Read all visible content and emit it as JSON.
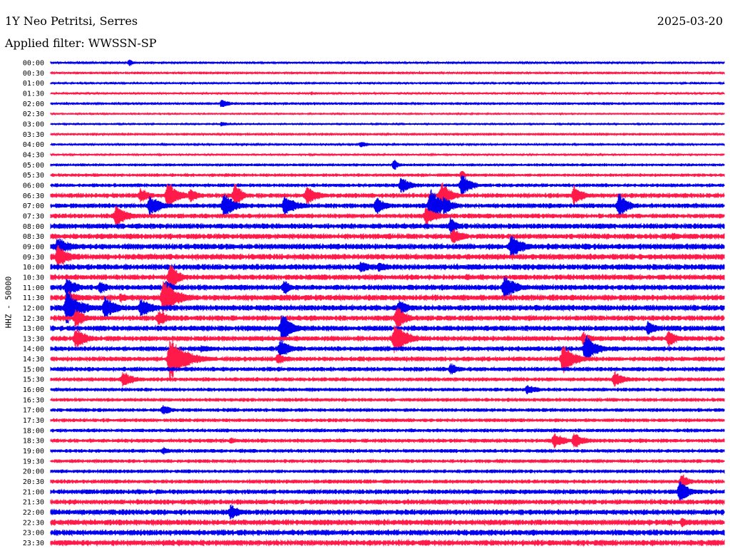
{
  "header": {
    "station": "1Y Neo Petritsi, Serres",
    "date": "2025-03-20",
    "filter": "Applied filter: WWSSN-SP",
    "channel": "HHZ - 50000"
  },
  "colors": {
    "trace_a": "#0000ee",
    "trace_b": "#ff1a4a",
    "text": "#000000"
  },
  "chart_data": {
    "type": "helicorder",
    "x": {
      "unit": "minutes past row start",
      "range": [
        0,
        30
      ]
    },
    "row_labels": [
      "00:00",
      "00:30",
      "01:00",
      "01:30",
      "02:00",
      "02:30",
      "03:00",
      "03:30",
      "04:00",
      "04:30",
      "05:00",
      "05:30",
      "06:00",
      "06:30",
      "07:00",
      "07:30",
      "08:00",
      "08:30",
      "09:00",
      "09:30",
      "10:00",
      "10:30",
      "11:00",
      "11:30",
      "12:00",
      "12:30",
      "13:00",
      "13:30",
      "14:00",
      "14:30",
      "15:00",
      "15:30",
      "16:00",
      "16:30",
      "17:00",
      "17:30",
      "18:00",
      "18:30",
      "19:00",
      "19:30",
      "20:00",
      "20:30",
      "21:00",
      "21:30",
      "22:00",
      "22:30",
      "23:00",
      "23:30"
    ],
    "series_color_pattern": [
      "trace_a",
      "trace_b"
    ],
    "noise_level": [
      1.0,
      1.2,
      0.8,
      0.8,
      1.2,
      0.7,
      0.7,
      1.2,
      0.9,
      0.8,
      1.3,
      1.6,
      1.8,
      2.4,
      2.4,
      2.4,
      2.8,
      2.8,
      3.0,
      3.0,
      3.0,
      2.8,
      2.8,
      3.0,
      3.0,
      2.8,
      2.8,
      2.6,
      2.4,
      2.4,
      2.2,
      2.0,
      1.8,
      1.8,
      1.8,
      1.8,
      1.8,
      2.0,
      1.8,
      1.8,
      1.8,
      2.0,
      2.4,
      2.6,
      2.8,
      3.0,
      3.0,
      3.0
    ],
    "events": [
      {
        "row": 0,
        "t": 3.5,
        "amp": 5,
        "dur": 0.2
      },
      {
        "row": 2,
        "t": 2.7,
        "amp": 2,
        "dur": 0.2
      },
      {
        "row": 3,
        "t": 11.6,
        "amp": 3,
        "dur": 0.3
      },
      {
        "row": 4,
        "t": 7.6,
        "amp": 6,
        "dur": 0.4
      },
      {
        "row": 6,
        "t": 7.6,
        "amp": 4,
        "dur": 0.3
      },
      {
        "row": 8,
        "t": 13.8,
        "amp": 5,
        "dur": 0.3
      },
      {
        "row": 10,
        "t": 15.3,
        "amp": 9,
        "dur": 0.2
      },
      {
        "row": 11,
        "t": 18.3,
        "amp": 8,
        "dur": 0.2
      },
      {
        "row": 12,
        "t": 15.6,
        "amp": 14,
        "dur": 0.4
      },
      {
        "row": 12,
        "t": 18.3,
        "amp": 18,
        "dur": 0.4
      },
      {
        "row": 13,
        "t": 4.0,
        "amp": 12,
        "dur": 0.4
      },
      {
        "row": 13,
        "t": 5.2,
        "amp": 22,
        "dur": 0.5
      },
      {
        "row": 13,
        "t": 6.2,
        "amp": 11,
        "dur": 0.4
      },
      {
        "row": 13,
        "t": 8.2,
        "amp": 22,
        "dur": 0.3
      },
      {
        "row": 13,
        "t": 11.4,
        "amp": 14,
        "dur": 0.5
      },
      {
        "row": 13,
        "t": 17.4,
        "amp": 24,
        "dur": 0.4
      },
      {
        "row": 13,
        "t": 23.3,
        "amp": 16,
        "dur": 0.4
      },
      {
        "row": 14,
        "t": 4.4,
        "amp": 16,
        "dur": 0.5
      },
      {
        "row": 14,
        "t": 7.7,
        "amp": 20,
        "dur": 0.5
      },
      {
        "row": 14,
        "t": 10.4,
        "amp": 15,
        "dur": 0.6
      },
      {
        "row": 14,
        "t": 14.5,
        "amp": 14,
        "dur": 0.4
      },
      {
        "row": 14,
        "t": 16.9,
        "amp": 28,
        "dur": 0.5
      },
      {
        "row": 14,
        "t": 17.5,
        "amp": 15,
        "dur": 0.4
      },
      {
        "row": 14,
        "t": 25.3,
        "amp": 20,
        "dur": 0.4
      },
      {
        "row": 15,
        "t": 2.9,
        "amp": 18,
        "dur": 0.5
      },
      {
        "row": 15,
        "t": 16.7,
        "amp": 14,
        "dur": 0.5
      },
      {
        "row": 16,
        "t": 17.8,
        "amp": 14,
        "dur": 0.3
      },
      {
        "row": 16,
        "t": 29.0,
        "amp": 3,
        "dur": 0.4
      },
      {
        "row": 17,
        "t": 17.9,
        "amp": 12,
        "dur": 0.5
      },
      {
        "row": 17,
        "t": 27.7,
        "amp": 6,
        "dur": 0.4
      },
      {
        "row": 18,
        "t": 20.5,
        "amp": 20,
        "dur": 0.5
      },
      {
        "row": 18,
        "t": 0.3,
        "amp": 14,
        "dur": 0.6
      },
      {
        "row": 19,
        "t": 0.3,
        "amp": 18,
        "dur": 0.5
      },
      {
        "row": 20,
        "t": 13.8,
        "amp": 10,
        "dur": 0.5
      },
      {
        "row": 20,
        "t": 14.6,
        "amp": 8,
        "dur": 0.5
      },
      {
        "row": 21,
        "t": 5.3,
        "amp": 22,
        "dur": 0.4
      },
      {
        "row": 21,
        "t": 18.5,
        "amp": 6,
        "dur": 0.4
      },
      {
        "row": 22,
        "t": 0.7,
        "amp": 15,
        "dur": 0.5
      },
      {
        "row": 22,
        "t": 2.2,
        "amp": 10,
        "dur": 0.4
      },
      {
        "row": 22,
        "t": 5.1,
        "amp": 12,
        "dur": 0.4
      },
      {
        "row": 22,
        "t": 10.4,
        "amp": 12,
        "dur": 0.3
      },
      {
        "row": 22,
        "t": 20.2,
        "amp": 20,
        "dur": 0.5
      },
      {
        "row": 23,
        "t": 0.8,
        "amp": 10,
        "dur": 0.5
      },
      {
        "row": 23,
        "t": 3.1,
        "amp": 8,
        "dur": 0.4
      },
      {
        "row": 23,
        "t": 5.0,
        "amp": 28,
        "dur": 0.6
      },
      {
        "row": 24,
        "t": 0.7,
        "amp": 28,
        "dur": 0.6
      },
      {
        "row": 24,
        "t": 2.4,
        "amp": 18,
        "dur": 0.5
      },
      {
        "row": 24,
        "t": 4.0,
        "amp": 16,
        "dur": 0.5
      },
      {
        "row": 24,
        "t": 15.5,
        "amp": 12,
        "dur": 0.5
      },
      {
        "row": 25,
        "t": 1.1,
        "amp": 16,
        "dur": 0.4
      },
      {
        "row": 25,
        "t": 4.8,
        "amp": 14,
        "dur": 0.4
      },
      {
        "row": 25,
        "t": 15.4,
        "amp": 20,
        "dur": 0.4
      },
      {
        "row": 26,
        "t": 10.3,
        "amp": 26,
        "dur": 0.4
      },
      {
        "row": 26,
        "t": 26.6,
        "amp": 12,
        "dur": 0.4
      },
      {
        "row": 27,
        "t": 1.1,
        "amp": 16,
        "dur": 0.5
      },
      {
        "row": 27,
        "t": 15.3,
        "amp": 24,
        "dur": 0.6
      },
      {
        "row": 27,
        "t": 23.7,
        "amp": 10,
        "dur": 0.4
      },
      {
        "row": 27,
        "t": 27.5,
        "amp": 14,
        "dur": 0.4
      },
      {
        "row": 28,
        "t": 6.7,
        "amp": 6,
        "dur": 0.6
      },
      {
        "row": 28,
        "t": 10.2,
        "amp": 16,
        "dur": 0.4
      },
      {
        "row": 28,
        "t": 23.8,
        "amp": 22,
        "dur": 0.5
      },
      {
        "row": 29,
        "t": 5.3,
        "amp": 35,
        "dur": 0.7
      },
      {
        "row": 29,
        "t": 10.1,
        "amp": 10,
        "dur": 0.4
      },
      {
        "row": 29,
        "t": 22.8,
        "amp": 24,
        "dur": 0.5
      },
      {
        "row": 30,
        "t": 17.8,
        "amp": 10,
        "dur": 0.4
      },
      {
        "row": 31,
        "t": 3.2,
        "amp": 12,
        "dur": 0.5
      },
      {
        "row": 31,
        "t": 25.1,
        "amp": 12,
        "dur": 0.5
      },
      {
        "row": 32,
        "t": 21.2,
        "amp": 7,
        "dur": 0.6
      },
      {
        "row": 34,
        "t": 5.0,
        "amp": 8,
        "dur": 0.4
      },
      {
        "row": 37,
        "t": 22.4,
        "amp": 12,
        "dur": 0.5
      },
      {
        "row": 37,
        "t": 23.3,
        "amp": 12,
        "dur": 0.5
      },
      {
        "row": 37,
        "t": 8.0,
        "amp": 5,
        "dur": 0.4
      },
      {
        "row": 38,
        "t": 5.0,
        "amp": 6,
        "dur": 0.4
      },
      {
        "row": 41,
        "t": 28.1,
        "amp": 14,
        "dur": 0.3
      },
      {
        "row": 42,
        "t": 28.0,
        "amp": 18,
        "dur": 0.4
      },
      {
        "row": 44,
        "t": 8.0,
        "amp": 12,
        "dur": 0.5
      },
      {
        "row": 45,
        "t": 28.1,
        "amp": 8,
        "dur": 0.3
      }
    ]
  }
}
